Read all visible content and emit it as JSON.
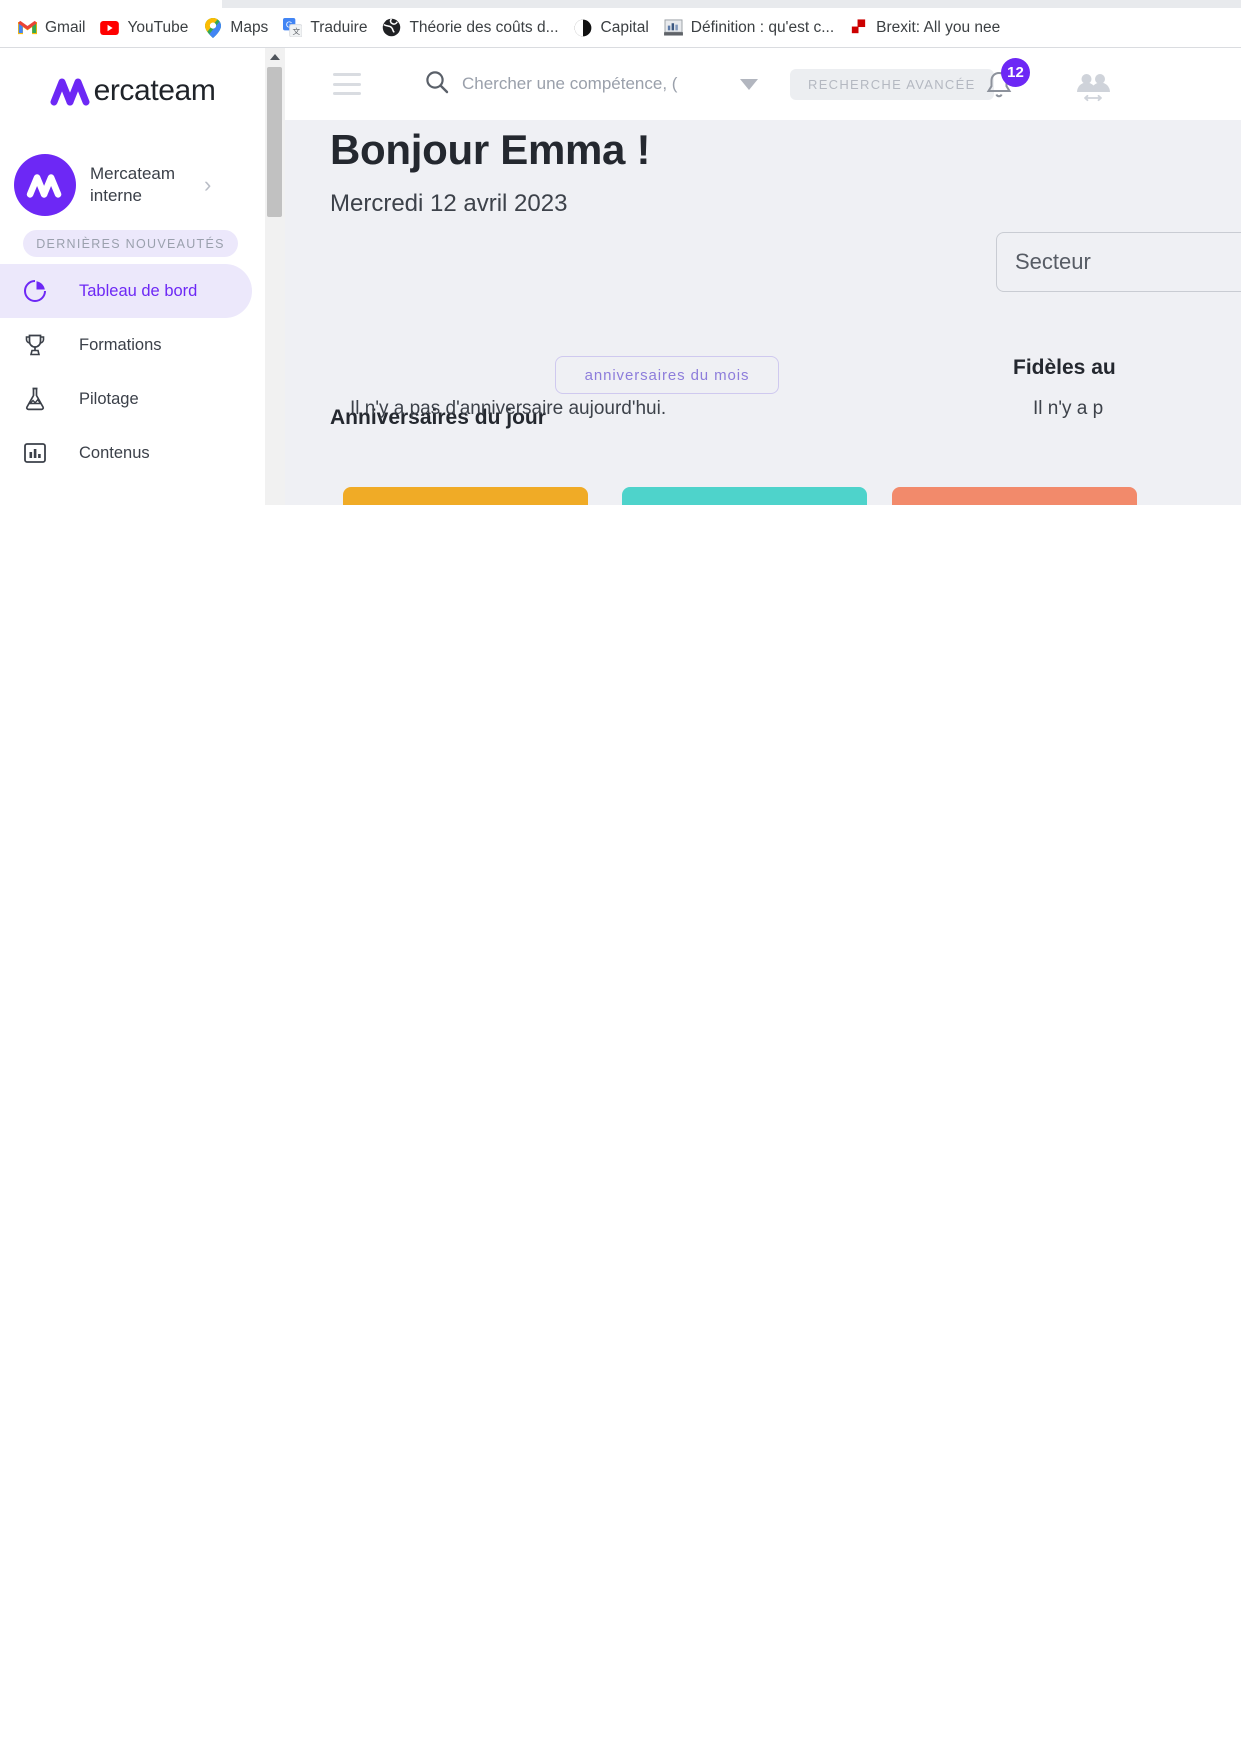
{
  "browser": {
    "bookmarks": [
      {
        "label": "Gmail",
        "icon": "gmail-icon"
      },
      {
        "label": "YouTube",
        "icon": "youtube-icon"
      },
      {
        "label": "Maps",
        "icon": "google-maps-icon"
      },
      {
        "label": "Traduire",
        "icon": "google-translate-icon"
      },
      {
        "label": "Théorie des coûts d...",
        "icon": "globe-icon"
      },
      {
        "label": "Capital",
        "icon": "capital-icon"
      },
      {
        "label": "Définition : qu'est c...",
        "icon": "chart-image-icon"
      },
      {
        "label": "Brexit: All you nee",
        "icon": "bbc-news-icon"
      }
    ]
  },
  "sidebar": {
    "logo_text": "ercateam",
    "logo_icon": "mercateam-logo-icon",
    "org": {
      "name_line1": "Mercateam",
      "name_line2": "interne",
      "chevron": "›",
      "avatar_icon": "mercateam-avatar-icon"
    },
    "news_pill": "DERNIÈRES NOUVEAUTÉS",
    "items": [
      {
        "label": "Tableau de bord",
        "icon": "pie-chart-icon",
        "active": true
      },
      {
        "label": "Formations",
        "icon": "trophy-icon",
        "active": false
      },
      {
        "label": "Pilotage",
        "icon": "flask-icon",
        "active": false
      },
      {
        "label": "Contenus",
        "icon": "bar-chart-icon",
        "active": false
      }
    ]
  },
  "topbar": {
    "menu_icon": "hamburger-menu-icon",
    "search": {
      "icon": "search-icon",
      "placeholder": "Chercher une compétence, (",
      "value": "",
      "caret_icon": "chevron-down-icon"
    },
    "advanced_search_label": "RECHERCHE AVANCÉE",
    "notifications": {
      "icon": "bell-icon",
      "count": "12"
    },
    "people_icon": "people-group-icon"
  },
  "dashboard": {
    "greeting": "Bonjour Emma !",
    "date": "Mercredi 12 avril 2023",
    "sector_filter": {
      "label": "Secteur"
    },
    "birthdays": {
      "title": "Anniversaires du jour",
      "month_button": "anniversaires du mois",
      "empty_text": "Il n'y a pas d'anniversaire aujourd'hui."
    },
    "loyal": {
      "title": "Fidèles au",
      "empty_text": "Il n'y a p"
    },
    "kpi_cards": [
      {
        "color": "#f0ab26"
      },
      {
        "color": "#4ed3cb"
      },
      {
        "color": "#f28a6b"
      }
    ]
  },
  "colors": {
    "brand_purple": "#6d28f5",
    "brand_purple_light": "#ece8fb",
    "page_bg": "#eff0f4",
    "text_dark": "#24282f",
    "text_muted": "#8d929c"
  }
}
